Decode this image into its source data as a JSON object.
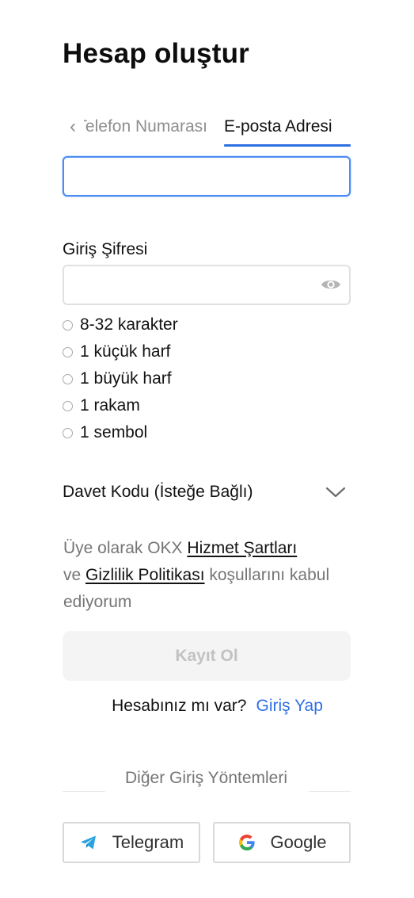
{
  "page": {
    "title": "Hesap oluştur"
  },
  "tabs": {
    "back_icon": "chevron-left-icon",
    "phone_label": "Telefon Numarası",
    "email_label": "E-posta Adresi",
    "active": "email",
    "accent_color": "#2f6fe4"
  },
  "email_field": {
    "value": "",
    "placeholder": ""
  },
  "password": {
    "label": "Giriş Şifresi",
    "value": "",
    "placeholder": "",
    "toggle_icon": "eye-icon"
  },
  "requirements": [
    {
      "text": "8-32 karakter"
    },
    {
      "text": "1 küçük harf"
    },
    {
      "text": "1 büyük harf"
    },
    {
      "text": "1 rakam"
    },
    {
      "text": "1 sembol"
    }
  ],
  "invite": {
    "label": "Davet Kodu (İsteğe Bağlı)",
    "icon": "chevron-down-icon"
  },
  "terms": {
    "prefix": "Üye olarak OKX ",
    "terms_link": "Hizmet Şartları",
    "middle": "ve ",
    "privacy_link": "Gizlilik Politikası",
    "suffix": " koşullarını kabul ediyorum"
  },
  "register": {
    "label": "Kayıt Ol"
  },
  "login": {
    "question": "Hesabınız mı var?",
    "link": "Giriş Yap"
  },
  "other_methods": {
    "label": "Diğer Giriş Yöntemleri"
  },
  "social": {
    "telegram_label": "Telegram",
    "telegram_icon": "telegram-icon",
    "google_label": "Google",
    "google_icon": "google-icon"
  }
}
